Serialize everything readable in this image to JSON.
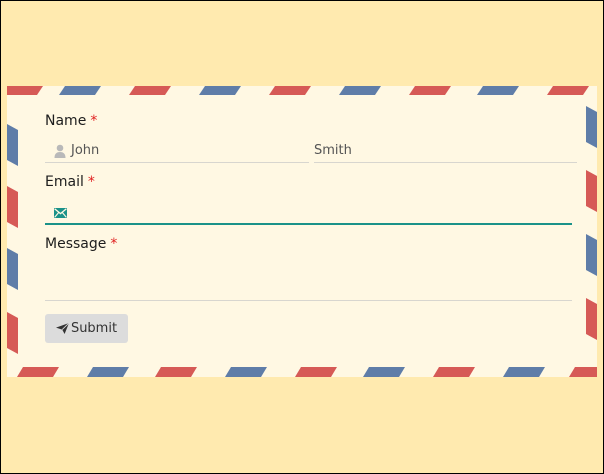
{
  "form": {
    "name_label": "Name",
    "name_required": "*",
    "first_name_value": "John",
    "last_name_value": "Smith",
    "email_label": "Email",
    "email_required": "*",
    "email_value": "",
    "message_label": "Message",
    "message_required": "*",
    "message_value": "",
    "submit_label": "Submit"
  },
  "icons": {
    "name": "user-icon",
    "email": "envelope-icon",
    "submit": "paper-plane-icon"
  },
  "colors": {
    "page_background": "#ffeaaf",
    "envelope_background": "#fff8e3",
    "stripe_red": "#d65a56",
    "stripe_blue": "#5f7da8",
    "focus_underline": "#1a9289",
    "required_asterisk": "#e02020"
  }
}
